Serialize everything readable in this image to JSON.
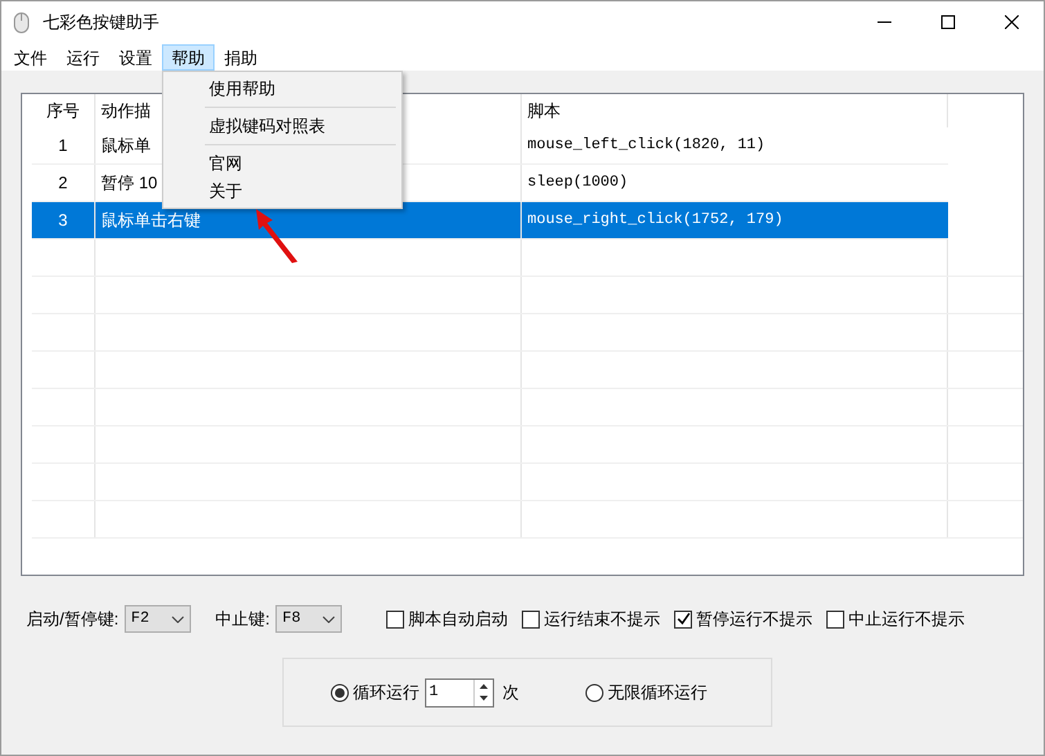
{
  "window": {
    "title": "七彩色按键助手"
  },
  "menu_bar": [
    {
      "label": "文件",
      "selected": false
    },
    {
      "label": "运行",
      "selected": false
    },
    {
      "label": "设置",
      "selected": false
    },
    {
      "label": "帮助",
      "selected": true
    },
    {
      "label": "捐助",
      "selected": false
    }
  ],
  "dropdown_menu": {
    "groups": [
      [
        "使用帮助"
      ],
      [
        "虚拟键码对照表"
      ],
      [
        "官网",
        "关于"
      ]
    ]
  },
  "table": {
    "columns": [
      "序号",
      "动作描",
      "脚本"
    ],
    "rows": [
      {
        "index": "1",
        "description": "鼠标单",
        "script": "mouse_left_click(1820, 11)",
        "selected": false
      },
      {
        "index": "2",
        "description": "暂停 10",
        "script": "sleep(1000)",
        "selected": false
      },
      {
        "index": "3",
        "description": "鼠标单击右键",
        "script": "mouse_right_click(1752, 179)",
        "selected": true
      }
    ]
  },
  "hotkeys": [
    {
      "label": "启动/暂停键:",
      "value": "F2"
    },
    {
      "label": "中止键:",
      "value": "F8"
    }
  ],
  "options": [
    {
      "label": "脚本自动启动",
      "checked": false
    },
    {
      "label": "运行结束不提示",
      "checked": false
    },
    {
      "label": "暂停运行不提示",
      "checked": true
    },
    {
      "label": "中止运行不提示",
      "checked": false
    }
  ],
  "loop": {
    "modes": [
      {
        "label": "循环运行",
        "selected": true
      },
      {
        "label": "无限循环运行",
        "selected": false
      }
    ],
    "count": "1",
    "unit": "次"
  }
}
